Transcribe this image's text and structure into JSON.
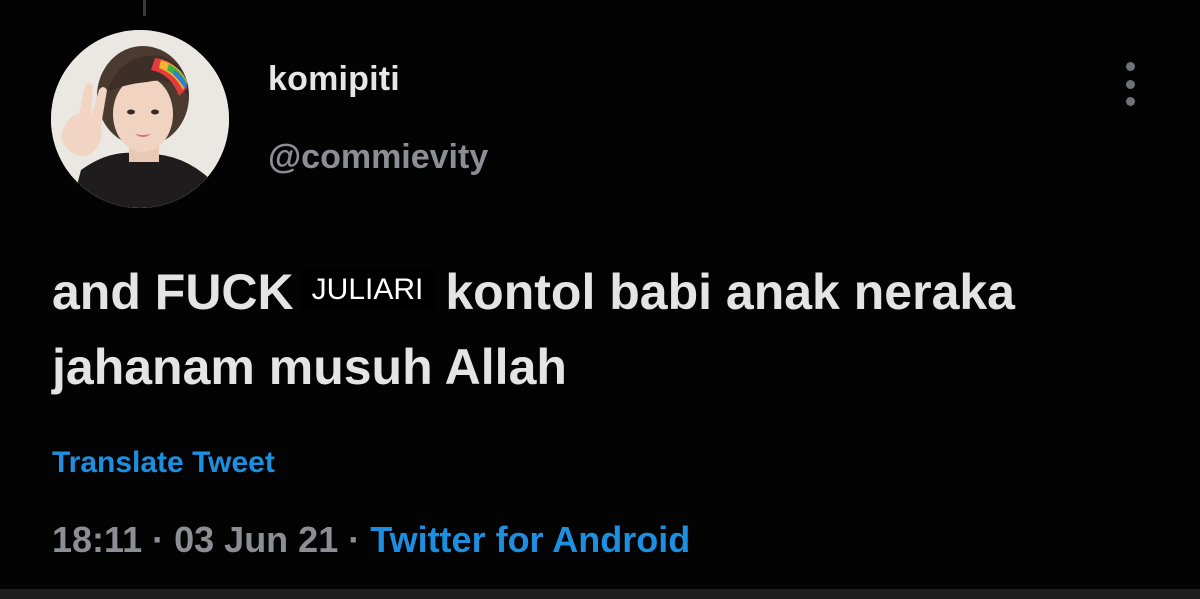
{
  "tweet": {
    "display_name": "komipiti",
    "handle": "@commievity",
    "text_before": "and FUCK",
    "redaction_label": "JULIARI",
    "text_after": "kontol babi anak neraka jahanam musuh Allah",
    "translate_label": "Translate Tweet",
    "time": "18:11",
    "separator": "·",
    "date": "03 Jun 21",
    "source": "Twitter for Android"
  },
  "icons": {
    "avatar": "profile-photo",
    "more": "more-vertical-icon"
  },
  "colors": {
    "background": "#030303",
    "primary_text": "#e6e6e6",
    "secondary_text": "#8b8f94",
    "link": "#1d8fe0"
  }
}
